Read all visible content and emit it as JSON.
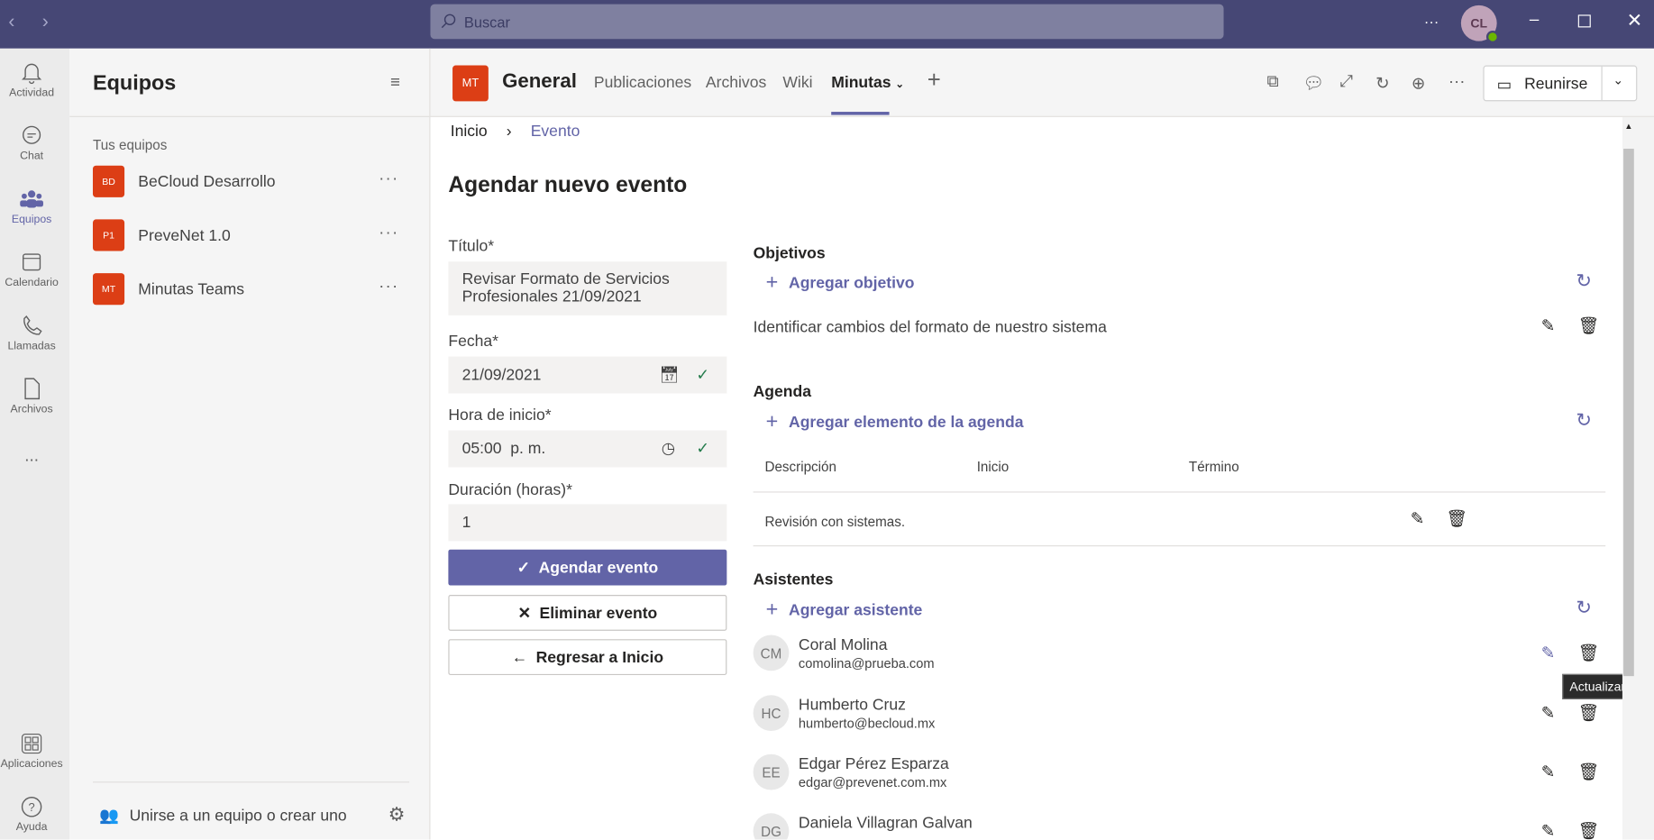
{
  "titlebar": {
    "search_placeholder": "Buscar",
    "user_initials": "CL"
  },
  "rail": {
    "items": [
      {
        "label": "Actividad"
      },
      {
        "label": "Chat"
      },
      {
        "label": "Equipos"
      },
      {
        "label": "Calendario"
      },
      {
        "label": "Llamadas"
      },
      {
        "label": "Archivos"
      },
      {
        "label": "Aplicaciones"
      },
      {
        "label": "Ayuda"
      }
    ],
    "more": "..."
  },
  "teams_panel": {
    "title": "Equipos",
    "section": "Tus equipos",
    "teams": [
      {
        "initials": "BD",
        "name": "BeCloud Desarrollo"
      },
      {
        "initials": "P1",
        "name": "PreveNet 1.0"
      },
      {
        "initials": "MT",
        "name": "Minutas Teams"
      }
    ],
    "more": "···",
    "join": "Unirse a un equipo o crear uno"
  },
  "header": {
    "logo": "MT",
    "channel": "General",
    "tabs": [
      "Publicaciones",
      "Archivos",
      "Wiki",
      "Minutas"
    ],
    "active_tab": "Minutas",
    "meet": "Reunirse",
    "accent": "#6264a7"
  },
  "breadcrumb": {
    "home": "Inicio",
    "current": "Evento"
  },
  "form": {
    "title": "Agendar nuevo evento",
    "titulo_label": "Título*",
    "titulo_value": "Revisar Formato de Servicios Profesionales 21/09/2021",
    "fecha_label": "Fecha*",
    "fecha_value": "21/09/2021",
    "hora_label": "Hora de inicio*",
    "hora_value": "05:00  p. m.",
    "duracion_label": "Duración (horas)*",
    "duracion_value": "1",
    "schedule_btn": "Agendar evento",
    "delete_btn": "Eliminar evento",
    "back_btn": "Regresar a Inicio"
  },
  "objetivos": {
    "title": "Objetivos",
    "add": "Agregar objetivo",
    "items": [
      "Identificar cambios del formato de nuestro sistema"
    ]
  },
  "agenda": {
    "title": "Agenda",
    "add": "Agregar elemento de la agenda",
    "columns": [
      "Descripción",
      "Inicio",
      "Término"
    ],
    "rows": [
      {
        "descripcion": "Revisión con sistemas.",
        "inicio": "",
        "termino": ""
      }
    ]
  },
  "asistentes": {
    "title": "Asistentes",
    "add": "Agregar asistente",
    "items": [
      {
        "initials": "CM",
        "name": "Coral Molina",
        "email": "comolina@prueba.com"
      },
      {
        "initials": "HC",
        "name": "Humberto Cruz",
        "email": "humberto@becloud.mx"
      },
      {
        "initials": "EE",
        "name": "Edgar Pérez Esparza",
        "email": "edgar@prevenet.com.mx"
      },
      {
        "initials": "DG",
        "name": "Daniela Villagran Galvan",
        "email": ""
      }
    ]
  },
  "tooltip": "Actualizar"
}
